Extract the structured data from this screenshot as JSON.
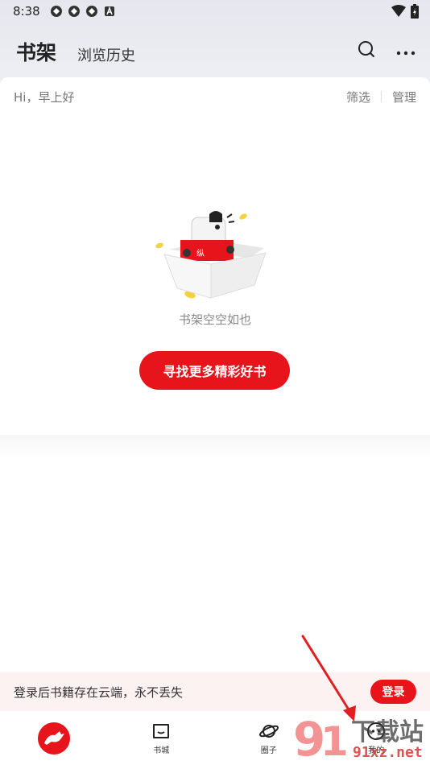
{
  "status_bar": {
    "time": "8:38"
  },
  "header": {
    "tab_bookshelf": "书架",
    "tab_history": "浏览历史"
  },
  "shelf": {
    "greeting": "Hi，早上好",
    "filter_label": "筛选",
    "manage_label": "管理",
    "empty_text": "书架空空如也",
    "find_button": "寻找更多精彩好书"
  },
  "login_banner": {
    "text": "登录后书籍存在云端，永不丢失",
    "button": "登录"
  },
  "bottom_nav": {
    "items": [
      {
        "label": "",
        "icon": "app-logo-icon"
      },
      {
        "label": "书城",
        "icon": "bookstore-icon"
      },
      {
        "label": "圈子",
        "icon": "planet-icon"
      },
      {
        "label": "我的",
        "icon": "profile-icon"
      }
    ]
  },
  "watermark": {
    "text": "下载站",
    "site": "91xz.net"
  },
  "colors": {
    "accent": "#e8141b",
    "banner_bg": "#fcf2f1"
  }
}
